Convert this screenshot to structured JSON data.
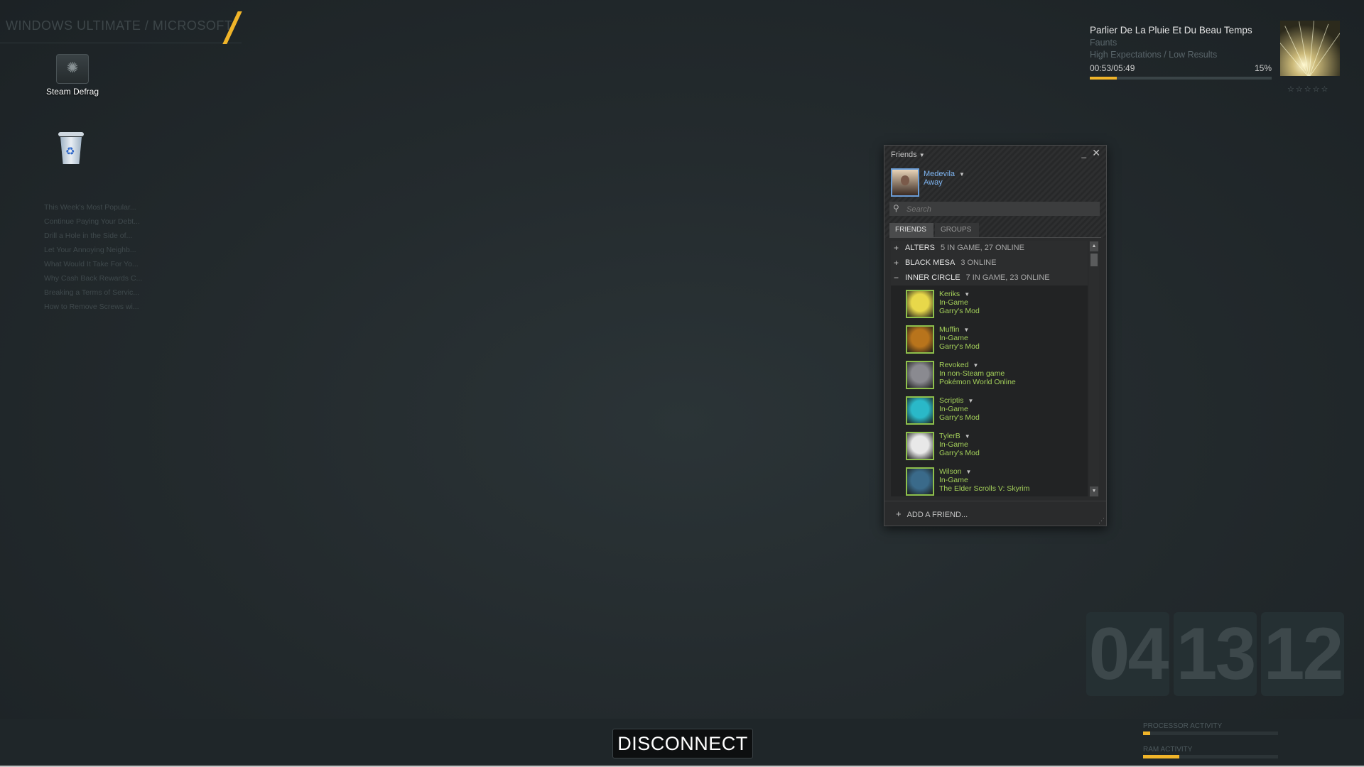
{
  "desktop": {
    "brand": "WINDOWS ULTIMATE / MICROSOFT",
    "icons": [
      {
        "label": "Steam Defrag"
      },
      {
        "label": ""
      }
    ],
    "news": [
      "This Week's Most Popular...",
      "Continue Paying Your Debt...",
      "Drill a Hole in the Side of...",
      "Let Your Annoying Neighb...",
      "What Would It Take For Yo...",
      "Why Cash Back Rewards C...",
      "Breaking a Terms of Servic...",
      "How to Remove Screws wi..."
    ]
  },
  "now_playing": {
    "title": "Parlier De La Pluie Et Du Beau Temps",
    "artist": "Faunts",
    "album": "High Expectations / Low Results",
    "time": "00:53/05:49",
    "percent_label": "15%",
    "progress": 0.15,
    "stars": "☆☆☆☆☆"
  },
  "friends_window": {
    "title": "Friends",
    "user": {
      "name": "Medevila",
      "status": "Away"
    },
    "search_placeholder": "Search",
    "tabs": [
      "FRIENDS",
      "GROUPS"
    ],
    "groups": [
      {
        "sign": "+",
        "name": "ALTERS",
        "info": "5 IN GAME, 27 ONLINE"
      },
      {
        "sign": "+",
        "name": "BLACK MESA",
        "info": "3 ONLINE"
      },
      {
        "sign": "−",
        "name": "INNER CIRCLE",
        "info": "7 IN GAME, 23 ONLINE"
      }
    ],
    "friends": [
      {
        "name": "Keriks",
        "status": "In-Game",
        "game": "Garry's Mod",
        "color": "#e8d84a"
      },
      {
        "name": "Muffin",
        "status": "In-Game",
        "game": "Garry's Mod",
        "color": "#b8741c"
      },
      {
        "name": "Revoked",
        "status": "In non-Steam game",
        "game": "Pokémon World Online",
        "color": "#8a8a90"
      },
      {
        "name": "Scriptis",
        "status": "In-Game",
        "game": "Garry's Mod",
        "color": "#2ab8c8"
      },
      {
        "name": "TylerB",
        "status": "In-Game",
        "game": "Garry's Mod",
        "color": "#e8e8e8"
      },
      {
        "name": "Wilson",
        "status": "In-Game",
        "game": "The Elder Scrolls V: Skyrim",
        "color": "#3a6a8a"
      }
    ],
    "add_friend": "ADD A FRIEND..."
  },
  "clock": {
    "hours": "04",
    "minutes": "13",
    "seconds": "12"
  },
  "taskbar": {
    "disconnect": "DISCONNECT",
    "processor_label": "PROCESSOR ACTIVITY",
    "processor_level": 0.05,
    "ram_label": "RAM ACTIVITY",
    "ram_level": 0.27
  },
  "colors": {
    "accent": "#f0b429",
    "ingame": "#a4d05a",
    "user": "#7eb4f0"
  }
}
